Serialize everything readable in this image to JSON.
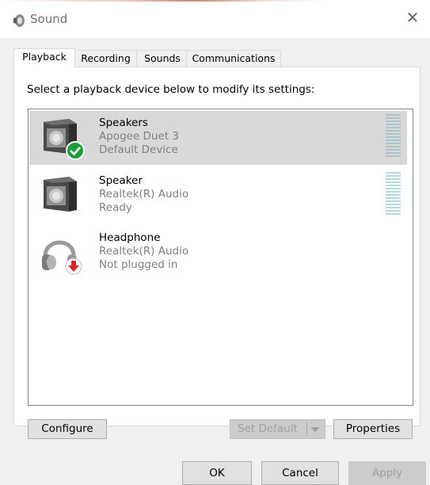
{
  "window": {
    "title": "Sound",
    "close_glyph": "✕"
  },
  "tabs": [
    {
      "label": "Playback",
      "active": true
    },
    {
      "label": "Recording"
    },
    {
      "label": "Sounds"
    },
    {
      "label": "Communications"
    }
  ],
  "instruction": "Select a playback device below to modify its settings:",
  "devices": [
    {
      "name": "Speakers",
      "driver": "Apogee Duet 3",
      "status": "Default Device",
      "icon": "speaker-icon",
      "badge": "default-check-icon",
      "selected": true
    },
    {
      "name": "Speaker",
      "driver": "Realtek(R) Audio",
      "status": "Ready",
      "icon": "speaker-icon",
      "selected": false
    },
    {
      "name": "Headphone",
      "driver": "Realtek(R) Audio",
      "status": "Not plugged in",
      "icon": "headphone-icon",
      "badge": "unplugged-arrow-icon",
      "selected": false
    }
  ],
  "buttons": {
    "configure": "Configure",
    "set_default": "Set Default",
    "properties": "Properties",
    "ok": "OK",
    "cancel": "Cancel",
    "apply": "Apply"
  },
  "colors": {
    "selection": "#d9d9d9",
    "meter": "#b4d8e1",
    "check": "#1e9e3a",
    "unplugged": "#d9232a"
  }
}
